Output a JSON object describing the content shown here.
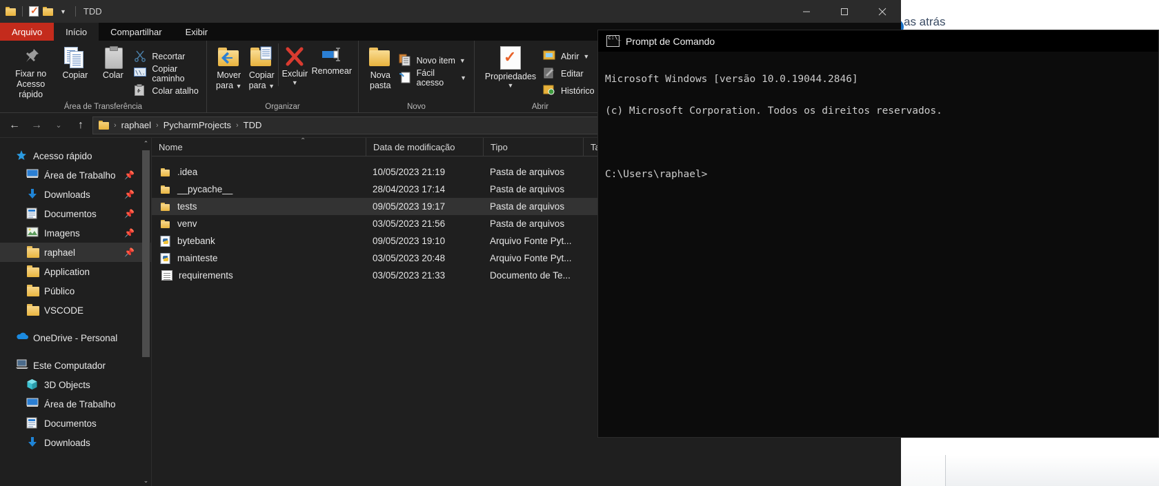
{
  "background": {
    "right_window_text": "as atrás"
  },
  "explorer": {
    "title": "TDD",
    "quick_access_icons": [
      "folder-icon",
      "properties-check-icon",
      "folder-icon"
    ],
    "window_controls": {
      "minimize": "minimize-icon",
      "maximize": "maximize-icon",
      "close": "close-icon"
    },
    "tabs": [
      {
        "label": "Arquivo",
        "kind": "file"
      },
      {
        "label": "Início",
        "kind": "active"
      },
      {
        "label": "Compartilhar",
        "kind": "normal"
      },
      {
        "label": "Exibir",
        "kind": "normal"
      }
    ],
    "ribbon": {
      "groups": [
        {
          "label": "Área de Transferência",
          "big_buttons": [
            {
              "label": "Fixar no\nAcesso rápido",
              "line1": "Fixar no",
              "line2": "Acesso rápido",
              "icon": "pin-icon"
            },
            {
              "label": "Copiar",
              "line1": "Copiar",
              "line2": "",
              "icon": "copy-icon"
            },
            {
              "label": "Colar",
              "line1": "Colar",
              "line2": "",
              "icon": "paste-icon"
            }
          ],
          "small_buttons": [
            {
              "label": "Recortar",
              "icon": "scissors-icon",
              "caret": false
            },
            {
              "label": "Copiar caminho",
              "icon": "copy-path-icon",
              "caret": false
            },
            {
              "label": "Colar atalho",
              "icon": "paste-shortcut-icon",
              "caret": false
            }
          ]
        },
        {
          "label": "Organizar",
          "big_buttons": [
            {
              "line1": "Mover",
              "line2": "para",
              "icon": "move-to-icon",
              "caret": true
            },
            {
              "line1": "Copiar",
              "line2": "para",
              "icon": "copy-to-icon",
              "caret": true
            },
            {
              "line1": "Excluir",
              "line2": "",
              "icon": "delete-icon",
              "caret": true
            },
            {
              "line1": "Renomear",
              "line2": "",
              "icon": "rename-icon",
              "caret": false
            }
          ],
          "small_buttons": []
        },
        {
          "label": "Novo",
          "big_buttons": [
            {
              "line1": "Nova",
              "line2": "pasta",
              "icon": "new-folder-icon",
              "caret": false
            }
          ],
          "small_buttons": [
            {
              "label": "Novo item",
              "icon": "new-item-icon",
              "caret": true
            },
            {
              "label": "Fácil acesso",
              "icon": "easy-access-icon",
              "caret": true
            }
          ]
        },
        {
          "label": "Abrir",
          "big_buttons": [
            {
              "line1": "Propriedades",
              "line2": "",
              "icon": "properties-icon",
              "caret": true
            }
          ],
          "small_buttons": [
            {
              "label": "Abrir",
              "icon": "open-icon",
              "caret": true
            },
            {
              "label": "Editar",
              "icon": "edit-icon",
              "caret": false
            },
            {
              "label": "Histórico",
              "icon": "history-icon",
              "caret": false
            }
          ]
        }
      ]
    },
    "address_bar": {
      "back": "back-arrow-icon",
      "forward": "forward-arrow-icon",
      "recent": "chevron-down-icon",
      "up": "up-arrow-icon",
      "breadcrumb_icon": "folder-icon",
      "breadcrumbs": [
        "raphael",
        "PycharmProjects",
        "TDD"
      ],
      "separator": "›",
      "dropdown": "chevron-down-icon"
    },
    "sidebar": {
      "items": [
        {
          "label": "Acesso rápido",
          "icon": "star-icon",
          "level": 0,
          "pinned": false,
          "selected": false
        },
        {
          "label": "Área de Trabalho",
          "icon": "desktop-icon",
          "level": 1,
          "pinned": true,
          "selected": false
        },
        {
          "label": "Downloads",
          "icon": "download-icon",
          "level": 1,
          "pinned": true,
          "selected": false
        },
        {
          "label": "Documentos",
          "icon": "documents-icon",
          "level": 1,
          "pinned": true,
          "selected": false
        },
        {
          "label": "Imagens",
          "icon": "pictures-icon",
          "level": 1,
          "pinned": true,
          "selected": false
        },
        {
          "label": "raphael",
          "icon": "folder-icon",
          "level": 1,
          "pinned": true,
          "selected": true
        },
        {
          "label": "Application",
          "icon": "folder-icon",
          "level": 1,
          "pinned": false,
          "selected": false
        },
        {
          "label": "Público",
          "icon": "folder-icon",
          "level": 1,
          "pinned": false,
          "selected": false
        },
        {
          "label": "VSCODE",
          "icon": "folder-icon",
          "level": 1,
          "pinned": false,
          "selected": false
        },
        {
          "label": "OneDrive - Personal",
          "icon": "onedrive-icon",
          "level": 0,
          "pinned": false,
          "selected": false
        },
        {
          "label": "Este Computador",
          "icon": "this-pc-icon",
          "level": 0,
          "pinned": false,
          "selected": false
        },
        {
          "label": "3D Objects",
          "icon": "3d-objects-icon",
          "level": 1,
          "pinned": false,
          "selected": false
        },
        {
          "label": "Área de Trabalho",
          "icon": "desktop-icon",
          "level": 1,
          "pinned": false,
          "selected": false
        },
        {
          "label": "Documentos",
          "icon": "documents-icon",
          "level": 1,
          "pinned": false,
          "selected": false
        },
        {
          "label": "Downloads",
          "icon": "download-icon",
          "level": 1,
          "pinned": false,
          "selected": false
        }
      ],
      "scroll_down_icon": "chevron-down-icon"
    },
    "file_list": {
      "columns": [
        "Nome",
        "Data de modificação",
        "Tipo",
        "Ta"
      ],
      "sort_column": "Nome",
      "sort_direction": "ascending",
      "rows": [
        {
          "name": ".idea",
          "modified": "10/05/2023 21:19",
          "type": "Pasta de arquivos",
          "icon": "folder-icon",
          "selected": false
        },
        {
          "name": "__pycache__",
          "modified": "28/04/2023 17:14",
          "type": "Pasta de arquivos",
          "icon": "folder-icon",
          "selected": false
        },
        {
          "name": "tests",
          "modified": "09/05/2023 19:17",
          "type": "Pasta de arquivos",
          "icon": "folder-icon",
          "selected": true
        },
        {
          "name": "venv",
          "modified": "03/05/2023 21:56",
          "type": "Pasta de arquivos",
          "icon": "folder-icon",
          "selected": false
        },
        {
          "name": "bytebank",
          "modified": "09/05/2023 19:10",
          "type": "Arquivo Fonte Pyt...",
          "icon": "python-file-icon",
          "selected": false
        },
        {
          "name": "mainteste",
          "modified": "03/05/2023 20:48",
          "type": "Arquivo Fonte Pyt...",
          "icon": "python-file-icon",
          "selected": false
        },
        {
          "name": "requirements",
          "modified": "03/05/2023 21:33",
          "type": "Documento de Te...",
          "icon": "text-file-icon",
          "selected": false
        }
      ]
    }
  },
  "command_prompt": {
    "title": "Prompt de Comando",
    "icon": "cmd-icon",
    "lines": [
      "Microsoft Windows [versão 10.0.19044.2846]",
      "(c) Microsoft Corporation. Todos os direitos reservados.",
      "",
      "C:\\Users\\raphael>"
    ]
  },
  "colors": {
    "file_tab_red": "#c42b1c",
    "window_bg": "#1f1f1f",
    "selection": "#333333",
    "cmd_bg": "#0c0c0c",
    "folder_yellow": "#e9b540"
  }
}
